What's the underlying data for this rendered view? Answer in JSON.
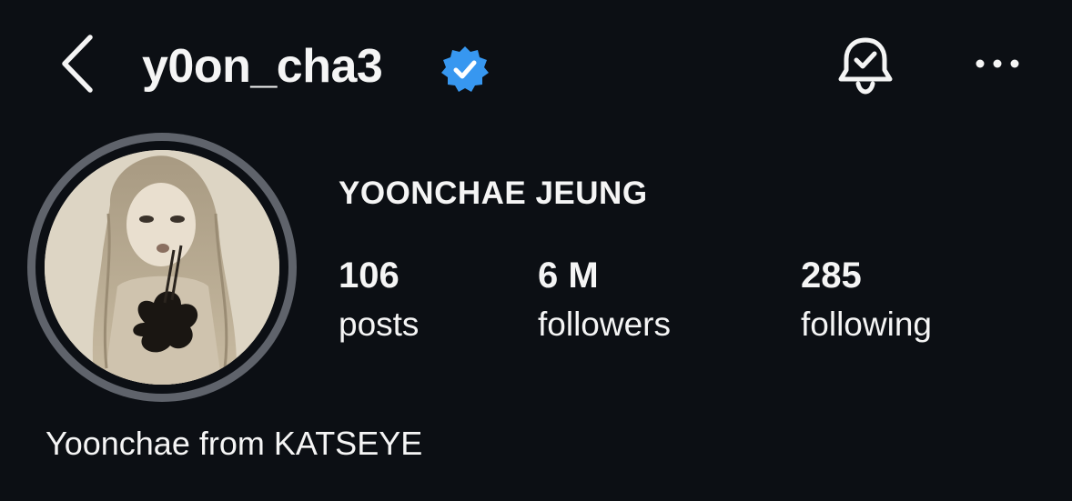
{
  "header": {
    "username": "y0on_cha3",
    "verified": true,
    "back_icon": "chevron-left-icon",
    "notification_icon": "bell-check-icon",
    "more_icon": "more-horizontal-icon"
  },
  "profile": {
    "full_name": "YOONCHAE JEUNG",
    "avatar_description": "profile photo",
    "stats": {
      "posts": {
        "count": "106",
        "label": "posts"
      },
      "followers": {
        "count": "6 M",
        "label": "followers"
      },
      "following": {
        "count": "285",
        "label": "following"
      }
    },
    "bio": "Yoonchae from KATSEYE"
  },
  "colors": {
    "background": "#0c0f14",
    "text": "#f5f5f5",
    "verified_badge": "#3797f0",
    "avatar_ring": "#5f636b"
  }
}
